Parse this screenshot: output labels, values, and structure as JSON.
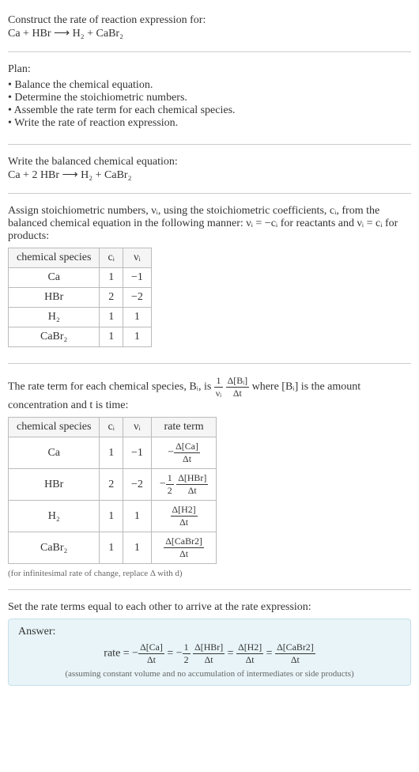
{
  "prompt": {
    "line1": "Construct the rate of reaction expression for:",
    "equation": "Ca + HBr ⟶ H₂ + CaBr₂"
  },
  "plan": {
    "title": "Plan:",
    "items": [
      "Balance the chemical equation.",
      "Determine the stoichiometric numbers.",
      "Assemble the rate term for each chemical species.",
      "Write the rate of reaction expression."
    ]
  },
  "balanced": {
    "title": "Write the balanced chemical equation:",
    "equation": "Ca + 2 HBr ⟶ H₂ + CaBr₂"
  },
  "assign": {
    "text1": "Assign stoichiometric numbers, νᵢ, using the stoichiometric coefficients, cᵢ, from the balanced chemical equation in the following manner: νᵢ = −cᵢ for reactants and νᵢ = cᵢ for products:",
    "table": {
      "headers": [
        "chemical species",
        "cᵢ",
        "νᵢ"
      ],
      "rows": [
        [
          "Ca",
          "1",
          "−1"
        ],
        [
          "HBr",
          "2",
          "−2"
        ],
        [
          "H₂",
          "1",
          "1"
        ],
        [
          "CaBr₂",
          "1",
          "1"
        ]
      ]
    }
  },
  "rate": {
    "text_pre": "The rate term for each chemical species, Bᵢ, is ",
    "text_post": " where [Bᵢ] is the amount concentration and t is time:",
    "frac1_num": "1",
    "frac1_den": "νᵢ",
    "frac2_num": "Δ[Bᵢ]",
    "frac2_den": "Δt",
    "table": {
      "headers": [
        "chemical species",
        "cᵢ",
        "νᵢ",
        "rate term"
      ],
      "rows": [
        {
          "species": "Ca",
          "c": "1",
          "v": "−1",
          "neg": "−",
          "coef": "",
          "num": "Δ[Ca]",
          "den": "Δt"
        },
        {
          "species": "HBr",
          "c": "2",
          "v": "−2",
          "neg": "−",
          "coef_num": "1",
          "coef_den": "2",
          "num": "Δ[HBr]",
          "den": "Δt"
        },
        {
          "species": "H₂",
          "c": "1",
          "v": "1",
          "neg": "",
          "coef": "",
          "num": "Δ[H2]",
          "den": "Δt"
        },
        {
          "species": "CaBr₂",
          "c": "1",
          "v": "1",
          "neg": "",
          "coef": "",
          "num": "Δ[CaBr2]",
          "den": "Δt"
        }
      ]
    },
    "note": "(for infinitesimal rate of change, replace Δ with d)"
  },
  "set": {
    "text": "Set the rate terms equal to each other to arrive at the rate expression:"
  },
  "answer": {
    "label": "Answer:",
    "rate_prefix": "rate = −",
    "t1_num": "Δ[Ca]",
    "t1_den": "Δt",
    "eq1": " = −",
    "half_num": "1",
    "half_den": "2",
    "t2_num": "Δ[HBr]",
    "t2_den": "Δt",
    "eq2": " = ",
    "t3_num": "Δ[H2]",
    "t3_den": "Δt",
    "eq3": " = ",
    "t4_num": "Δ[CaBr2]",
    "t4_den": "Δt",
    "note": "(assuming constant volume and no accumulation of intermediates or side products)"
  }
}
